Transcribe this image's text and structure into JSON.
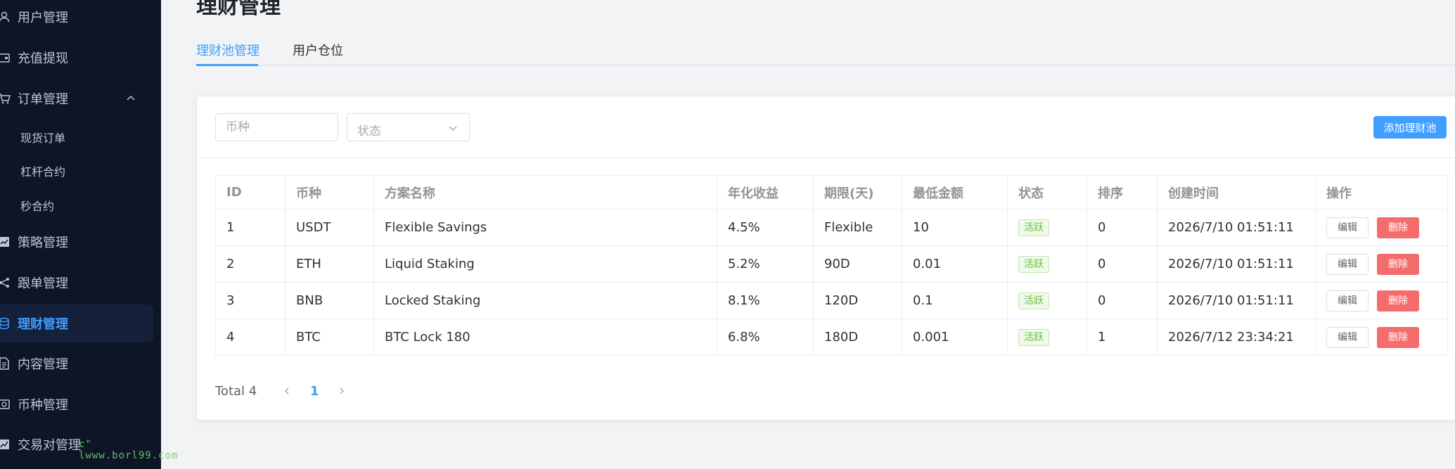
{
  "sidebar": {
    "items": [
      {
        "label": "用户管理",
        "icon": "user-icon"
      },
      {
        "label": "充值提现",
        "icon": "wallet-icon"
      },
      {
        "label": "订单管理",
        "icon": "cart-icon"
      },
      {
        "label": "策略管理",
        "icon": "chart-icon"
      },
      {
        "label": "跟单管理",
        "icon": "share-icon"
      },
      {
        "label": "理财管理",
        "icon": "database-icon"
      },
      {
        "label": "内容管理",
        "icon": "document-icon"
      },
      {
        "label": "币种管理",
        "icon": "coin-icon"
      },
      {
        "label": "交易对管理",
        "icon": "trend-icon"
      }
    ],
    "sub_items": [
      "现货订单",
      "杠杆合约",
      "秒合约"
    ],
    "watermark": "c\" lwww.borl99.com"
  },
  "page": {
    "title": "理财管理"
  },
  "tabs": [
    "理财池管理",
    "用户仓位"
  ],
  "filters": {
    "coin_placeholder": "币种",
    "status_placeholder": "状态",
    "add_label": "添加理财池"
  },
  "table": {
    "headers": [
      "ID",
      "币种",
      "方案名称",
      "年化收益",
      "期限(天)",
      "最低金额",
      "状态",
      "排序",
      "创建时间",
      "操作"
    ],
    "rows": [
      {
        "id": "1",
        "coin": "USDT",
        "name": "Flexible Savings",
        "apy": "4.5%",
        "term": "Flexible",
        "min": "10",
        "status": "活跃",
        "sort": "0",
        "created": "2026/7/10 01:51:11"
      },
      {
        "id": "2",
        "coin": "ETH",
        "name": "Liquid Staking",
        "apy": "5.2%",
        "term": "90D",
        "min": "0.01",
        "status": "活跃",
        "sort": "0",
        "created": "2026/7/10 01:51:11"
      },
      {
        "id": "3",
        "coin": "BNB",
        "name": "Locked Staking",
        "apy": "8.1%",
        "term": "120D",
        "min": "0.1",
        "status": "活跃",
        "sort": "0",
        "created": "2026/7/10 01:51:11"
      },
      {
        "id": "4",
        "coin": "BTC",
        "name": "BTC Lock 180",
        "apy": "6.8%",
        "term": "180D",
        "min": "0.001",
        "status": "活跃",
        "sort": "1",
        "created": "2026/7/12 23:34:21"
      }
    ],
    "edit_label": "编辑",
    "delete_label": "删除"
  },
  "pagination": {
    "total": "Total 4",
    "current": "1"
  },
  "colors": {
    "accent": "#409eff",
    "danger": "#f56c6c",
    "success": "#67c23a",
    "sidebar_bg": "#0d1527"
  }
}
